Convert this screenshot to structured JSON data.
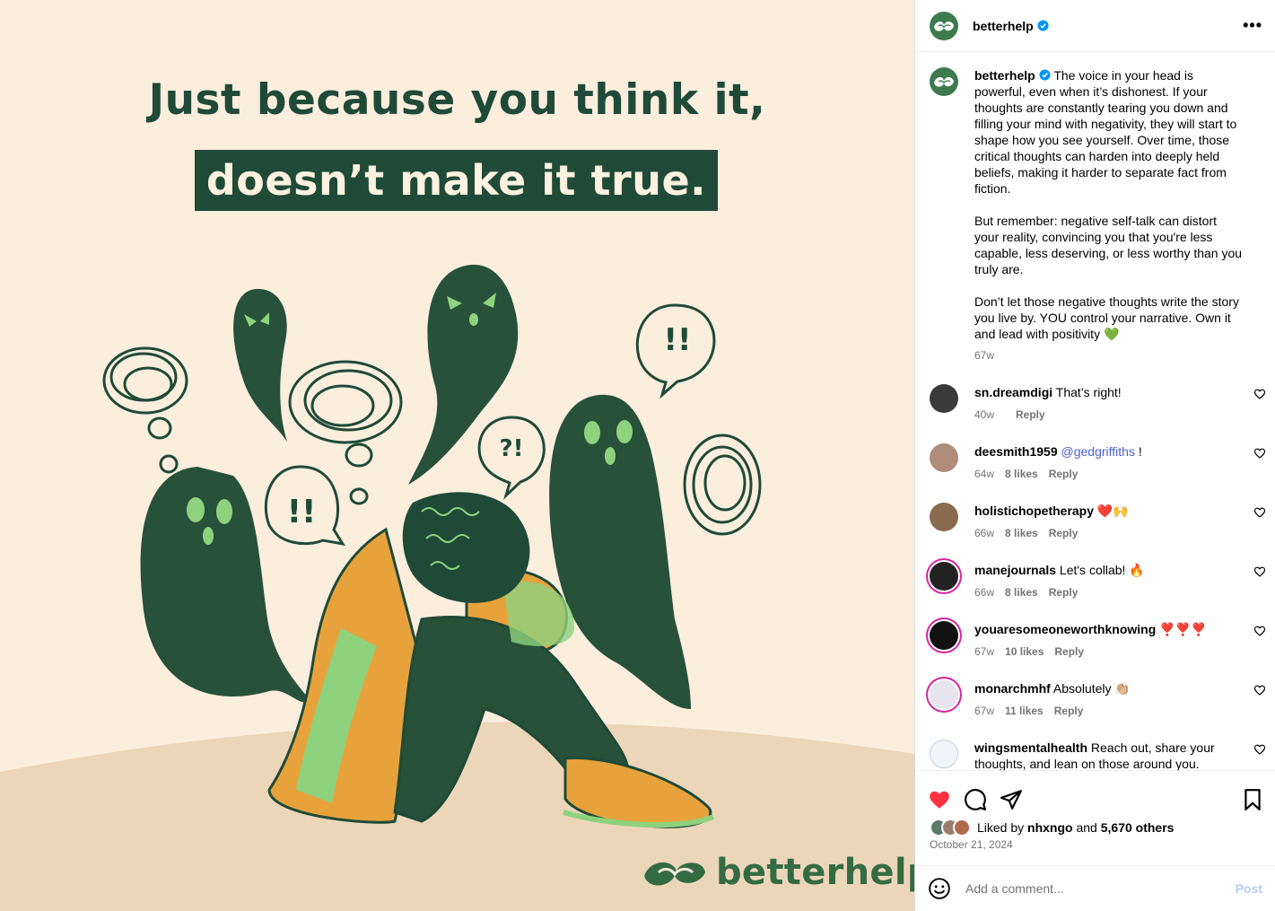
{
  "post_image": {
    "headline_line1": "Just because you think it,",
    "headline_line2": "doesn’t make it true.",
    "brand_text": "betterhelp",
    "bubble_marks": [
      "?!",
      "!!",
      "!!"
    ]
  },
  "header": {
    "username": "betterhelp",
    "verified_icon": "verified-badge-icon",
    "more_icon": "more-options-icon"
  },
  "caption": {
    "username": "betterhelp",
    "paragraph1": "The voice in your head is powerful, even when it’s dishonest. If your thoughts are constantly tearing you down and filling your mind with negativity, they will start to shape how you see yourself. Over time, those critical thoughts can harden into deeply held beliefs, making it harder to separate fact from fiction.",
    "paragraph2": "But remember: negative self-talk can distort your reality, convincing you that you're less capable, less deserving, or less worthy than you truly are.",
    "paragraph3": "Don’t let those negative thoughts write the story you live by. YOU control your narrative. Own it and lead with positivity 💚",
    "time": "67w"
  },
  "comments": [
    {
      "username": "sn.dreamdigi",
      "text": "That’s right!",
      "mention": "",
      "time": "40w",
      "likes": "",
      "reply": "Reply",
      "avatar_color": "#3a3a3a"
    },
    {
      "username": "deesmith1959",
      "text": "!",
      "mention": "@gedgriffiths",
      "time": "64w",
      "likes": "8 likes",
      "reply": "Reply",
      "avatar_color": "#b08c7a"
    },
    {
      "username": "holistichopetherapy",
      "text": "❤️🙌",
      "mention": "",
      "time": "66w",
      "likes": "8 likes",
      "reply": "Reply",
      "avatar_color": "#8a6b4f"
    },
    {
      "username": "manejournals",
      "text": "Let's collab! 🔥",
      "mention": "",
      "time": "66w",
      "likes": "8 likes",
      "reply": "Reply",
      "avatar_color": "#222222"
    },
    {
      "username": "youaresomeoneworthknowing",
      "text": "❣️❣️❣️",
      "mention": "",
      "time": "67w",
      "likes": "10 likes",
      "reply": "Reply",
      "avatar_color": "#111111"
    },
    {
      "username": "monarchmhf",
      "text": "Absolutely 👏🏼",
      "mention": "",
      "time": "67w",
      "likes": "11 likes",
      "reply": "Reply",
      "avatar_color": "#e7e4f0"
    },
    {
      "username": "wingsmentalhealth",
      "text": "Reach out, share your thoughts, and lean on those around you.",
      "mention": "",
      "time": "",
      "likes": "",
      "reply": "",
      "avatar_color": "#f1f4f8"
    }
  ],
  "actions": {
    "like_icon": "heart-filled-icon",
    "comment_icon": "comment-icon",
    "share_icon": "share-icon",
    "save_icon": "bookmark-icon",
    "like_color": "#ff3040",
    "liked_by_prefix": "Liked by",
    "liked_by_user": "nhxngo",
    "and": "and",
    "others": "5,670 others",
    "date": "October 21, 2024"
  },
  "add_comment": {
    "placeholder": "Add a comment...",
    "post_label": "Post",
    "emoji_icon": "emoji-icon"
  }
}
